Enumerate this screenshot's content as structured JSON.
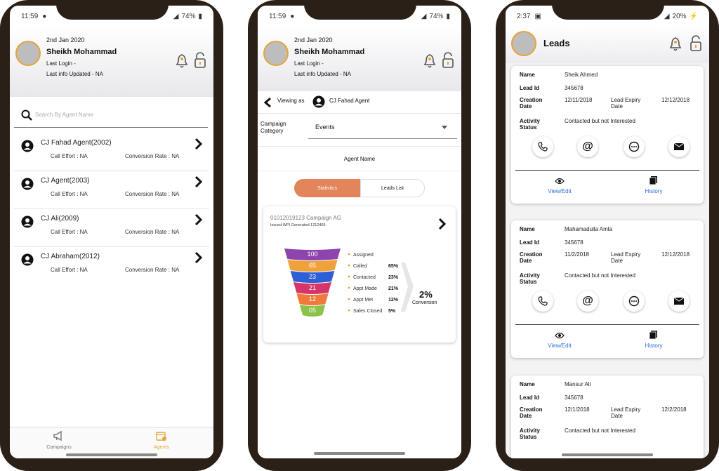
{
  "status": {
    "phone1": {
      "time": "11:59",
      "battery": "74%"
    },
    "phone2": {
      "time": "11:59",
      "battery": "74%"
    },
    "phone3": {
      "time": "2:37",
      "battery": "20%"
    }
  },
  "profile": {
    "date": "2nd Jan 2020",
    "name": "Sheikh Mohammad",
    "last_login": "Last Login -",
    "last_info": "Last info Updated - NA"
  },
  "agents_screen": {
    "search_placeholder": "Search By Agent Name",
    "agents": [
      {
        "name": "CJ Fahad Agent(2002)",
        "effort": "Call Effort : NA",
        "conversion": "Conversion Rate : NA"
      },
      {
        "name": "CJ Agent(2003)",
        "effort": "Call Effort : NA",
        "conversion": "Conversion Rate : NA"
      },
      {
        "name": "CJ Ali(2009)",
        "effort": "Call Effort : NA",
        "conversion": "Conversion Rate : NA"
      },
      {
        "name": "CJ Abraham(2012)",
        "effort": "Call Effort : NA",
        "conversion": "Conversion Rate : NA"
      }
    ],
    "bottom_nav": [
      {
        "label": "Campaigns",
        "active": false
      },
      {
        "label": "Agents",
        "active": true
      }
    ]
  },
  "stats_screen": {
    "viewing_as_label": "Viewing as",
    "viewing_as_agent": "CJ Fahad Agent",
    "campaign_category_label": "Campaign Category",
    "campaign_category_value": "Events",
    "agent_name_label": "Agent Name",
    "tabs": [
      {
        "label": "Statistics",
        "active": true
      },
      {
        "label": "Leads List",
        "active": false
      }
    ],
    "campaign_title": "01012019123 Campaign AG",
    "campaign_sub": "Issued WPI Generated 1212465",
    "conversion_value": "2%",
    "conversion_label": "Conversion"
  },
  "chart_data": {
    "type": "funnel",
    "stages": [
      {
        "label": "Assigned",
        "value": 100,
        "percent": "",
        "color": "#8e44ad"
      },
      {
        "label": "Called",
        "value": 65,
        "percent": "65%",
        "color": "#f0a23a"
      },
      {
        "label": "Contacted",
        "value": 23,
        "percent": "23%",
        "color": "#2f5fd6"
      },
      {
        "label": "Appt Made",
        "value": 21,
        "percent": "21%",
        "color": "#d6356a"
      },
      {
        "label": "Appt Met",
        "value": 12,
        "percent": "12%",
        "color": "#f07a3a"
      },
      {
        "label": "Sales Closed",
        "value": "05",
        "percent": "5%",
        "color": "#8bc34a"
      }
    ]
  },
  "leads_screen": {
    "title": "Leads",
    "labels": {
      "name": "Name",
      "lead_id": "Lead Id",
      "creation": "Creation Date",
      "expiry": "Lead Expiry Date",
      "activity": "Activity Status",
      "view_edit": "View/Edit",
      "history": "History"
    },
    "leads": [
      {
        "name": "Sheik Ahmed",
        "id": "345678",
        "created": "12/11/2018",
        "expiry": "12/12/2018",
        "status": "Contacted but not Interested"
      },
      {
        "name": "Mahamadulla Amla",
        "id": "345678",
        "created": "11/2/2018",
        "expiry": "12/12/2018",
        "status": "Contacted but not Interested"
      },
      {
        "name": "Mansur Ali",
        "id": "345678",
        "created": "12/1/2018",
        "expiry": "12/2/2018",
        "status": "Contacted but not Interested"
      }
    ]
  },
  "colors": {
    "accent": "#e8a33a",
    "tab_active": "#e2855a",
    "link": "#2f6fd6",
    "frame": "#2b2018"
  }
}
